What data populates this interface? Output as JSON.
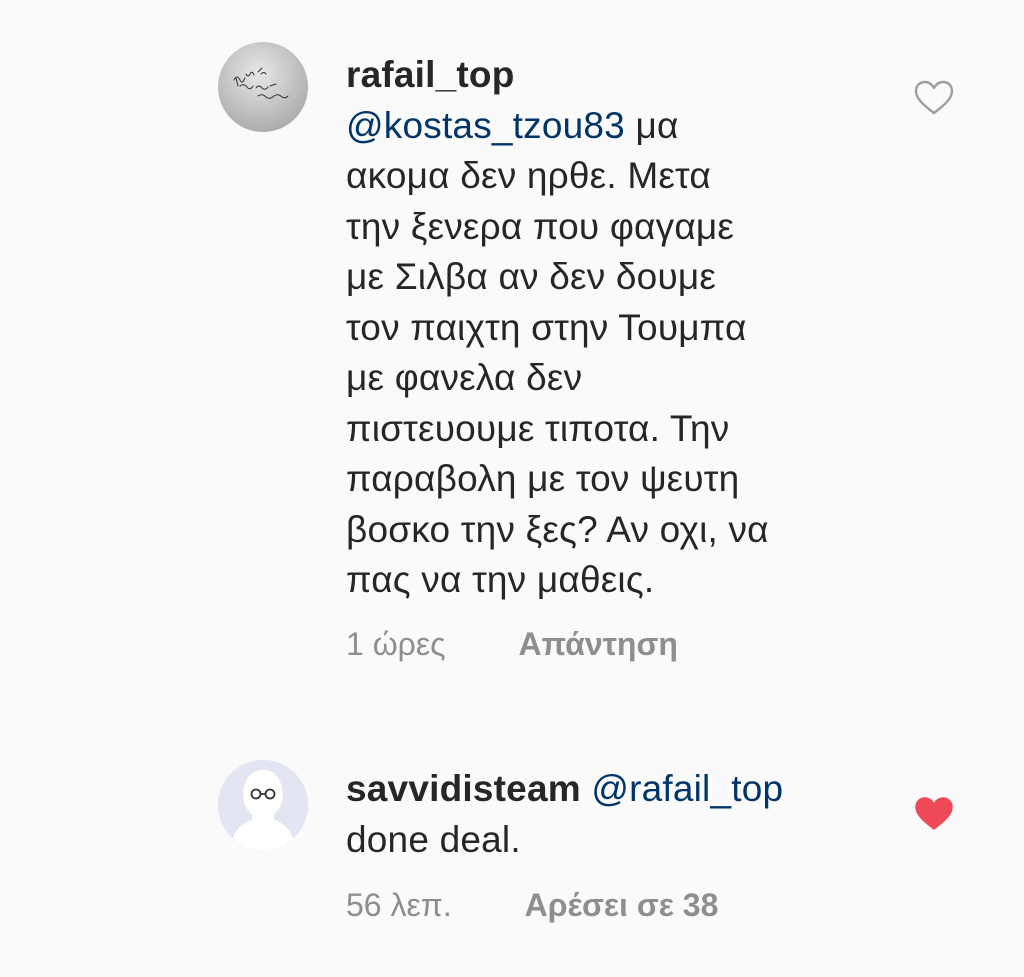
{
  "comments": [
    {
      "username": "rafail_top",
      "mention": "@kostas_tzou83",
      "text_lines": [
        "μα",
        "ακομα δεν ηρθε. Μετα",
        "την ξενερα που φαγαμε",
        "με Σιλβα αν δεν δουμε",
        "τον παιχτη στην Τουμπα",
        "με φανελα δεν",
        "πιστευουμε τιποτα. Την",
        "παραβολη με τον ψευτη",
        "βοσκο την ξες? Αν οχι, να",
        "πας να την μαθεις."
      ],
      "time": "1 ώρες",
      "action": "Απάντηση",
      "liked": false,
      "like_icon": "heart-outline-icon"
    },
    {
      "username": "savvidisteam",
      "mention": "@rafail_top",
      "text_lines": [
        "done deal."
      ],
      "time": "56 λεπ.",
      "action": "Αρέσει σε 38",
      "liked": true,
      "like_icon": "heart-filled-icon"
    }
  ],
  "colors": {
    "background": "#fafafa",
    "text": "#262626",
    "mention": "#003569",
    "meta": "#8e8e8e",
    "liked_heart": "#ed4956",
    "unliked_heart": "#9e9e9e"
  }
}
